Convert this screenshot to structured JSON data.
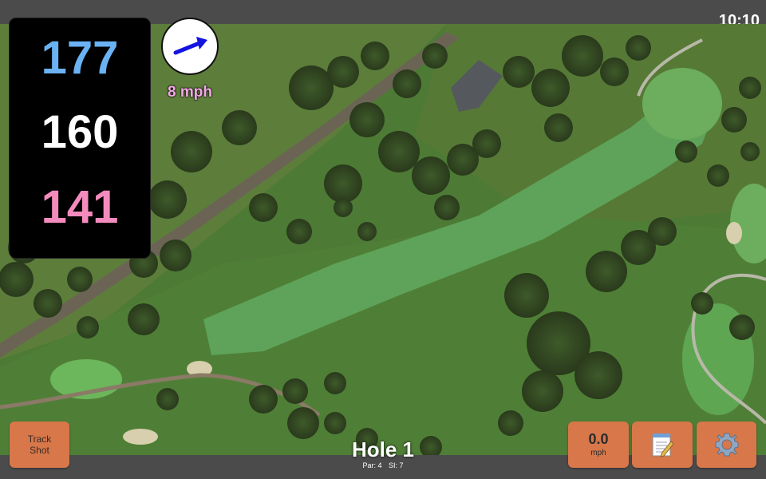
{
  "status_bar": {
    "time": "10:10"
  },
  "distances": {
    "back": "177",
    "middle": "160",
    "front": "141"
  },
  "wind": {
    "speed": "8 mph",
    "direction_icon": "arrow-right-icon"
  },
  "hole": {
    "title": "Hole 1",
    "par": "Par: 4",
    "stroke_index": "SI: 7"
  },
  "buttons": {
    "track_shot_line1": "Track",
    "track_shot_line2": "Shot",
    "speed_value": "0.0",
    "speed_unit": "mph",
    "notes_icon": "notepad-icon",
    "settings_icon": "gear-icon"
  },
  "colors": {
    "back": "#6bb2f4",
    "middle": "#ffffff",
    "front": "#f48bbd",
    "wind_text": "#f4a7e6",
    "button": "#d7774a"
  }
}
